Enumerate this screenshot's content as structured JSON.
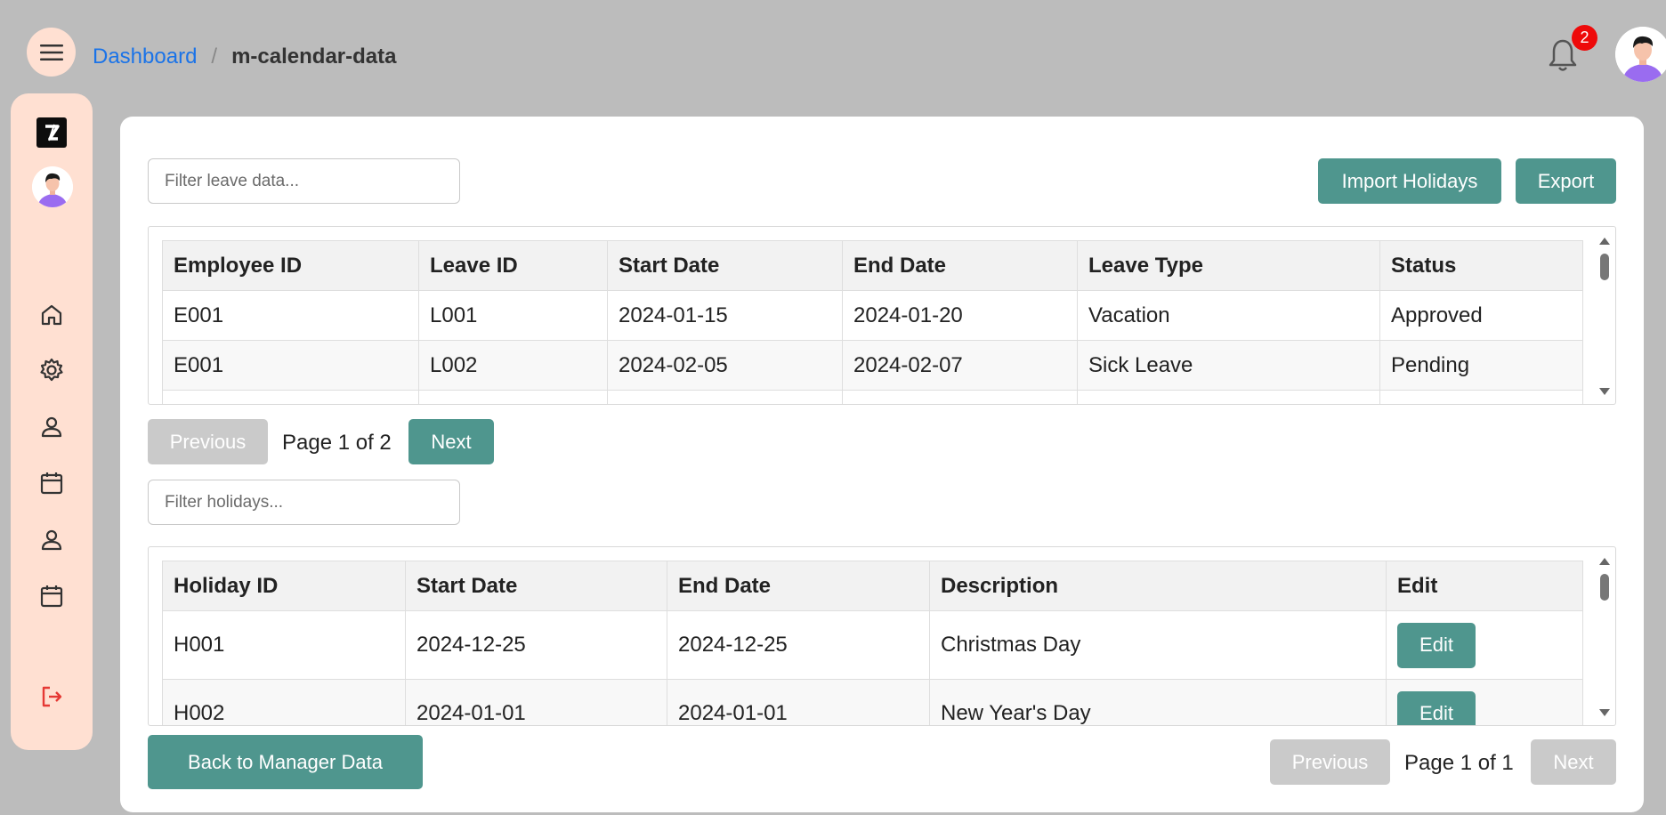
{
  "header": {
    "breadcrumb_link": "Dashboard",
    "breadcrumb_sep": "/",
    "breadcrumb_current": "m-calendar-data",
    "notification_count": "2"
  },
  "sidebar": {
    "items": [
      {
        "name": "home-icon"
      },
      {
        "name": "gear-icon"
      },
      {
        "name": "user-icon"
      },
      {
        "name": "calendar-icon"
      },
      {
        "name": "user-icon"
      },
      {
        "name": "calendar-icon"
      },
      {
        "name": "logout-icon"
      }
    ]
  },
  "leave": {
    "filter_placeholder": "Filter leave data...",
    "import_label": "Import Holidays",
    "export_label": "Export",
    "columns": [
      "Employee ID",
      "Leave ID",
      "Start Date",
      "End Date",
      "Leave Type",
      "Status"
    ],
    "rows": [
      [
        "E001",
        "L001",
        "2024-01-15",
        "2024-01-20",
        "Vacation",
        "Approved"
      ],
      [
        "E001",
        "L002",
        "2024-02-05",
        "2024-02-07",
        "Sick Leave",
        "Pending"
      ]
    ],
    "prev_label": "Previous",
    "page_text": "Page 1 of 2",
    "next_label": "Next"
  },
  "holidays": {
    "filter_placeholder": "Filter holidays...",
    "columns": [
      "Holiday ID",
      "Start Date",
      "End Date",
      "Description",
      "Edit"
    ],
    "rows": [
      [
        "H001",
        "2024-12-25",
        "2024-12-25",
        "Christmas Day",
        "Edit"
      ],
      [
        "H002",
        "2024-01-01",
        "2024-01-01",
        "New Year's Day",
        "Edit"
      ]
    ],
    "back_label": "Back to Manager Data",
    "prev_label": "Previous",
    "page_text": "Page 1 of 1",
    "next_label": "Next"
  },
  "colors": {
    "accent": "#4f968e",
    "sidebar_bg": "#ffe0d2",
    "link": "#1a73e8",
    "badge": "#ee0a0a",
    "logout": "#e53935"
  }
}
